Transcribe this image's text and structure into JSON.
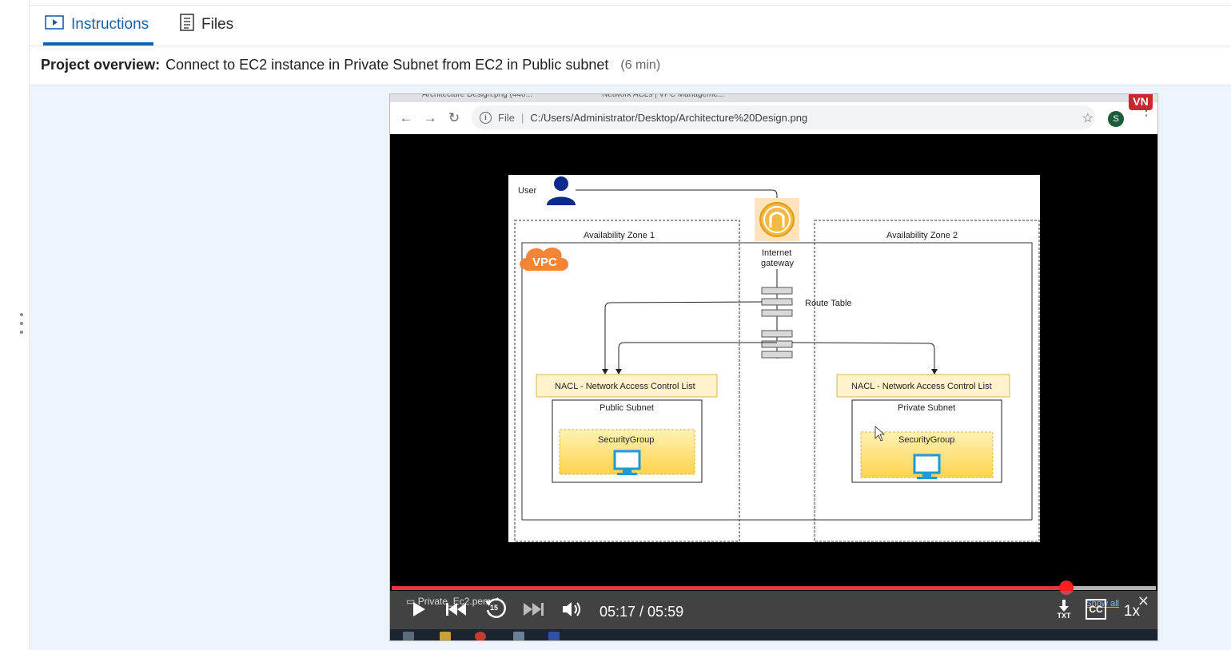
{
  "tabs": [
    {
      "label": "Instructions",
      "icon": "play-video-icon",
      "active": true
    },
    {
      "label": "Files",
      "icon": "document-icon",
      "active": false
    }
  ],
  "overview": {
    "label": "Project overview:",
    "title": "Connect to EC2 instance in Private Subnet from EC2 in Public subnet",
    "duration": "(6 min)"
  },
  "browser": {
    "tab1": "Architecture Design.png (440...",
    "tab2": "Network ACLs | VPC Manageme...",
    "scheme_label": "File",
    "url": "C:/Users/Administrator/Desktop/Architecture%20Design.png",
    "profile_initial": "S",
    "corner_logo": "VN"
  },
  "diagram": {
    "user_label": "User",
    "az1_label": "Availability Zone 1",
    "az2_label": "Availability Zone 2",
    "vpc_label": "VPC",
    "igw_label_line1": "Internet",
    "igw_label_line2": "gateway",
    "route_table_label": "Route Table",
    "nacl1_label": "NACL - Network Access Control List",
    "nacl2_label": "NACL - Network Access Control List",
    "public_subnet_label": "Public Subnet",
    "private_subnet_label": "Private Subnet",
    "sg1_label": "SecurityGroup",
    "sg2_label": "SecurityGroup"
  },
  "player": {
    "current_time": "05:17",
    "total_time": "05:59",
    "time_display": "05:17 / 05:59",
    "progress_fraction": 0.883,
    "speed": "1x",
    "download_file": "Private_Ec2.pem",
    "show_all": "Show all",
    "rewind_seconds": "15",
    "transcript_label": "TXT",
    "cc_label": "CC"
  },
  "colors": {
    "accent": "#1b5fa8",
    "progress": "#e53935",
    "content_bg": "#eef4fb",
    "nacl_fill": "#fff2cc",
    "sg_fill": "#ffd966",
    "vpc_orange": "#f58536",
    "igw_orange": "#f4b942"
  }
}
